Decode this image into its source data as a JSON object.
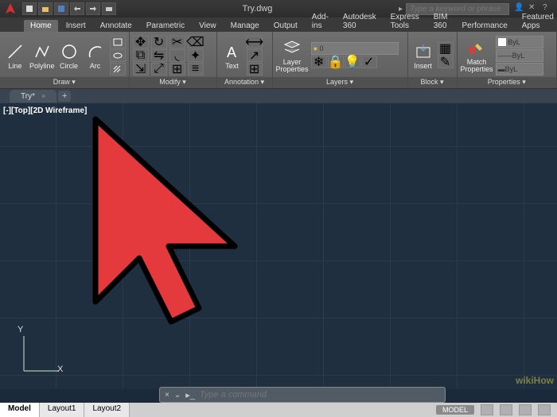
{
  "titlebar": {
    "filename": "Try.dwg",
    "search_placeholder": "Type a keyword or phrase"
  },
  "ribbon_tabs": [
    "Home",
    "Insert",
    "Annotate",
    "Parametric",
    "View",
    "Manage",
    "Output",
    "Add-ins",
    "Autodesk 360",
    "Express Tools",
    "BIM 360",
    "Performance",
    "Featured Apps"
  ],
  "active_tab": "Home",
  "panels": {
    "draw": {
      "label": "Draw ▾",
      "items": {
        "line": "Line",
        "polyline": "Polyline",
        "circle": "Circle",
        "arc": "Arc"
      }
    },
    "modify": {
      "label": "Modify ▾"
    },
    "annotation": {
      "label": "Annotation ▾",
      "text": "Text"
    },
    "layers": {
      "label": "Layers ▾",
      "layer_properties": "Layer\nProperties",
      "dropdown": "0"
    },
    "block": {
      "label": "Block ▾",
      "insert": "Insert"
    },
    "properties": {
      "label": "Properties ▾",
      "match": "Match\nProperties",
      "layer": "ByL",
      "color": "ByL"
    }
  },
  "file_tabs": {
    "current": "Try*"
  },
  "viewport": {
    "label": "[-][Top][2D Wireframe]"
  },
  "command": {
    "placeholder": "Type a command"
  },
  "layout_tabs": [
    "Model",
    "Layout1",
    "Layout2"
  ],
  "active_layout": "Model",
  "status": {
    "model": "MODEL"
  },
  "ucs": {
    "y": "Y",
    "x": "X"
  },
  "watermark": "wikiHow"
}
